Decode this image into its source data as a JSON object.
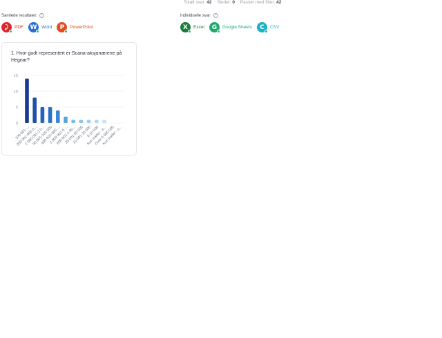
{
  "header": {
    "stats": [
      {
        "label": "Totalt svar:",
        "value": "42"
      },
      {
        "label": "Slettet:",
        "value": "0"
      },
      {
        "label": "Passer med filter:",
        "value": "42"
      }
    ]
  },
  "combined_results": {
    "title": "Samlede resultater:",
    "help_icon": "?",
    "exports": [
      {
        "label": "PDF",
        "letter": "⤸",
        "color": "#e0262b",
        "text_color": "#e0262b"
      },
      {
        "label": "Word",
        "letter": "W",
        "color": "#2b6fd6",
        "text_color": "#2b6fd6"
      },
      {
        "label": "PowerPoint",
        "letter": "P",
        "color": "#e04e24",
        "text_color": "#e04e24"
      }
    ]
  },
  "individual_answers": {
    "title": "Individuelle svar:",
    "help_icon": "?",
    "exports": [
      {
        "label": "Excel",
        "letter": "X",
        "color": "#1f7a3d",
        "text_color": "#1f7a3d"
      },
      {
        "label": "Google Sheets",
        "letter": "G",
        "color": "#1eaa6e",
        "text_color": "#1eaa6e"
      },
      {
        "label": "CSV",
        "letter": "C",
        "color": "#19b2c4",
        "text_color": "#19b2c4"
      }
    ]
  },
  "colors": {
    "badge": "#1eb980"
  },
  "question": {
    "title": "1. Hvor godt representert er Scana-aksjonærene på Hegnar?"
  },
  "chart_data": {
    "type": "bar",
    "categories": [
      "100 001-...",
      "200 001-400 0...",
      "1 000 001-2 0...",
      "50 001-100 000",
      "400 001-600 ...",
      "2 000 001-5 ...",
      "600 001-1 00...",
      "25 001-50 000",
      "10 001-25 000",
      "0-10 000",
      "Kun trader - a...",
      "Over 5 000 000",
      "Kun trader - s..."
    ],
    "values": [
      14,
      8,
      5,
      5,
      4,
      2,
      1,
      1,
      1,
      1,
      1,
      0,
      0
    ],
    "colors": [
      "#1a3a8f",
      "#1f4fa8",
      "#2563b8",
      "#2a72c6",
      "#3d86d4",
      "#5aa3de",
      "#75b9e6",
      "#8ac6ea",
      "#9cd0ee",
      "#aed9f2",
      "#bfe2f5",
      "#cfe9f7",
      "#dbeffa"
    ],
    "yticks": [
      0,
      5,
      10,
      15
    ],
    "ylim": [
      0,
      15
    ],
    "title": "",
    "xlabel": "",
    "ylabel": "",
    "grid": true
  }
}
